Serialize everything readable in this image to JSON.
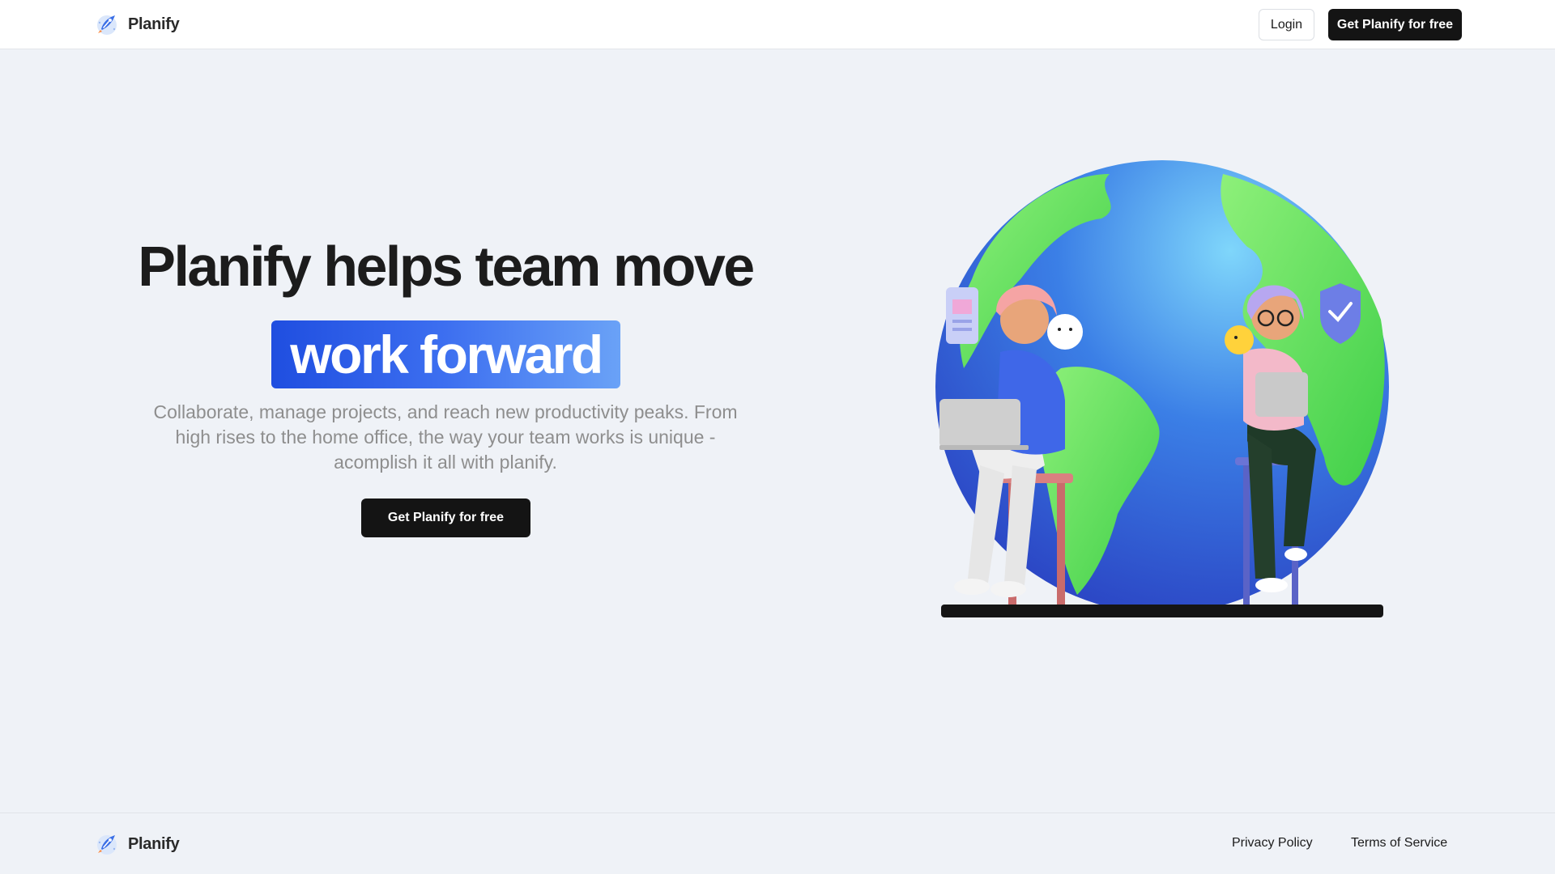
{
  "header": {
    "brand_name": "Planify",
    "login_label": "Login",
    "cta_label": "Get Planify for free"
  },
  "hero": {
    "title": "Planify helps team move",
    "highlight": "work forward",
    "subtitle": "Collaborate, manage projects, and reach new productivity peaks. From high rises to the home office, the way your team works is unique - acomplish it all with planify.",
    "cta_label": "Get Planify for free"
  },
  "footer": {
    "brand_name": "Planify",
    "privacy_label": "Privacy Policy",
    "terms_label": "Terms of Service"
  },
  "colors": {
    "background": "#eff2f7",
    "primary_button": "#141414",
    "highlight_start": "#1f4ee0",
    "highlight_end": "#6aa2f7"
  },
  "icons": {
    "logo": "planify-rocket-logo-icon",
    "illustration": "globe-with-two-remote-workers-illustration"
  }
}
